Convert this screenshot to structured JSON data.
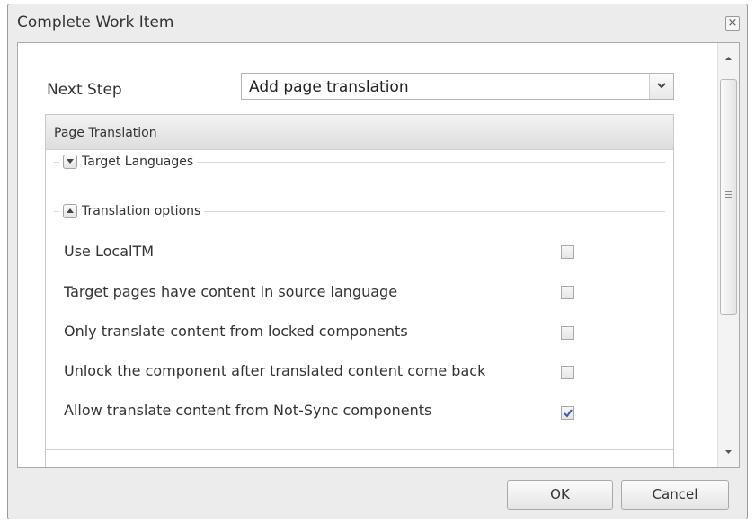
{
  "dialog": {
    "title": "Complete Work Item",
    "close_label": "×"
  },
  "form": {
    "next_step_label": "Next Step",
    "next_step_value": "Add page translation"
  },
  "panel": {
    "header": "Page Translation",
    "sections": {
      "target_languages": "Target Languages",
      "translation_options": "Translation options"
    },
    "options": [
      {
        "label": "Use LocalTM",
        "checked": false
      },
      {
        "label": "Target pages have content in source language",
        "checked": false
      },
      {
        "label": "Only translate content from locked components",
        "checked": false
      },
      {
        "label": "Unlock the component after translated content come back",
        "checked": false
      },
      {
        "label": "Allow translate content from Not-Sync components",
        "checked": true
      }
    ]
  },
  "buttons": {
    "ok": "OK",
    "cancel": "Cancel"
  },
  "colors": {
    "check_mark": "#3a5fa8"
  }
}
